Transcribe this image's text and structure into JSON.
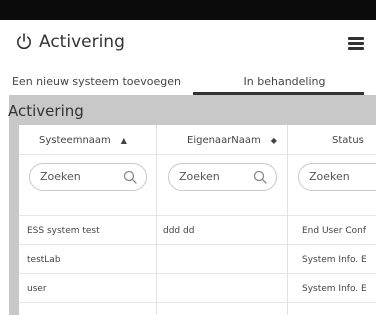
{
  "header": {
    "title": "Activering",
    "power_icon": "power-icon",
    "menu_icon": "hamburger-menu-icon"
  },
  "tabs": [
    {
      "label": "Een nieuw systeem toevoegen",
      "active": false
    },
    {
      "label": "In behandeling",
      "active": true
    }
  ],
  "panel": {
    "title": "Activering"
  },
  "table": {
    "columns": [
      {
        "label": "Systeemnaam",
        "sort_icon": "▲"
      },
      {
        "label": "EigenaarNaam",
        "sort_icon": "◆"
      },
      {
        "label": "Status",
        "sort_icon": ""
      }
    ],
    "search_placeholder": "Zoeken",
    "rows": [
      {
        "system": "ESS system test",
        "owner": "ddd dd",
        "status": "End User Conf"
      },
      {
        "system": "testLab",
        "owner": "",
        "status": "System Info. E"
      },
      {
        "system": "user",
        "owner": "",
        "status": "System Info. E"
      }
    ]
  },
  "colors": {
    "topbar": "#0b0b0b",
    "panel_bg": "#c8c8c8",
    "active_tab_underline": "#333333"
  }
}
